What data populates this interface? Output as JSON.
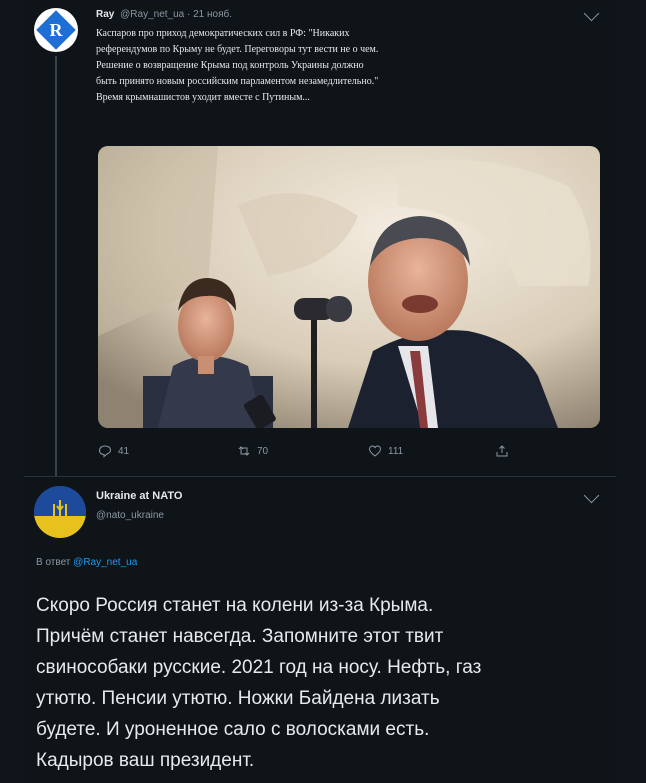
{
  "tweet1": {
    "author_name": "Ray",
    "author_handle": "@Ray_net_ua · 21 нояб.",
    "avatar_letter": "R",
    "text_lines": [
      "Каспаров про приход демократических сил в РФ: \"Никаких",
      "референдумов по Крыму не будет. Переговоры тут вести не о чем.",
      "Решение о возвращение Крыма под контроль Украины должно",
      "быть принято новым российским парламентом незамедлительно.\"",
      "Время крымнашистов уходит вместе с Путиным..."
    ],
    "reply_count": "41",
    "retweet_count": "70",
    "like_count": "111"
  },
  "tweet2": {
    "author_name": "Ukraine at NATO",
    "author_handle": "@nato_ukraine",
    "reply_prefix": "В ответ",
    "reply_handle": "@Ray_net_ua",
    "text_lines": [
      "Скоро Россия станет на колени из-за Крыма.",
      "Причём станет навсегда. Запомните этот твит",
      "свинособаки русские. 2021 год на носу. Нефть, газ",
      "утютю. Пенсии утютю. Ножки Байдена лизать",
      "будете. И уроненное сало с волосками есть.",
      "Кадыров ваш президент."
    ]
  },
  "colors": {
    "background": "#0f1419",
    "link": "#1d9bf0",
    "secondary_text": "#8b98a5"
  }
}
